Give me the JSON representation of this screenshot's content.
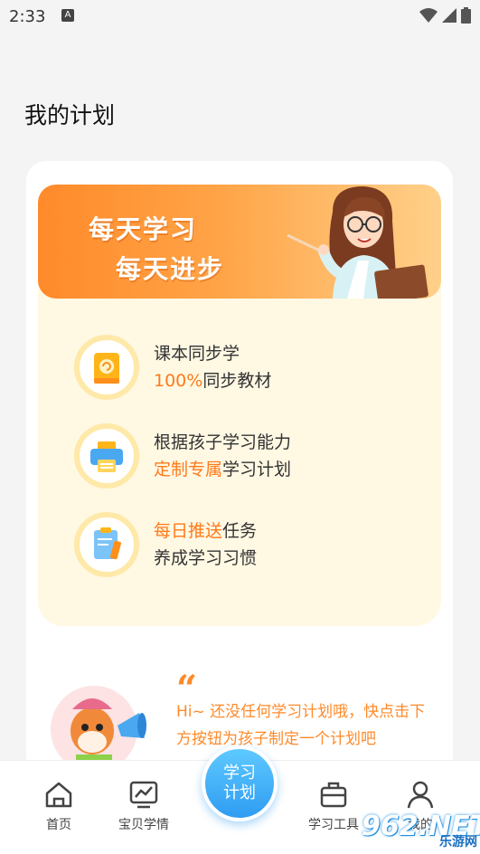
{
  "status_bar": {
    "time": "2:33",
    "notification_letter": "A"
  },
  "page_title": "我的计划",
  "banner": {
    "line1": "每天学习",
    "line2": "每天进步"
  },
  "features": [
    {
      "line1": [
        {
          "text": "课本同步学",
          "hl": false
        }
      ],
      "line2": [
        {
          "text": "100%",
          "hl": true
        },
        {
          "text": "同步教材",
          "hl": false
        }
      ],
      "icon": "textbook-icon"
    },
    {
      "line1": [
        {
          "text": "根据孩子学习能力",
          "hl": false
        }
      ],
      "line2": [
        {
          "text": "定制专属",
          "hl": true
        },
        {
          "text": "学习计划",
          "hl": false
        }
      ],
      "icon": "printer-icon"
    },
    {
      "line1": [
        {
          "text": "每日推送",
          "hl": true
        },
        {
          "text": "任务",
          "hl": false
        }
      ],
      "line2": [
        {
          "text": "养成学习习惯",
          "hl": false
        }
      ],
      "icon": "clipboard-icon"
    }
  ],
  "f1": {
    "a": "课本同步学",
    "b_hl": "100%",
    "b": "同步教材"
  },
  "f2": {
    "a": "根据孩子学习能力",
    "b_hl": "定制专属",
    "b": "学习计划"
  },
  "f3": {
    "a_hl": "每日推送",
    "a": "任务",
    "b": "养成学习习惯"
  },
  "quote_mark": "“",
  "hint_text": "Hi~ 还没任何学习计划哦，快点击下方按钮为孩子制定一个计划吧",
  "tabs": {
    "home": "首页",
    "baby": "宝贝学情",
    "center_line1": "学习",
    "center_line2": "计划",
    "tools": "学习工具",
    "me": "我的"
  },
  "watermark": {
    "main": "962.NET",
    "sub": "乐游网"
  },
  "colors": {
    "accent": "#ff7a1a",
    "blue": "#2f9cf2",
    "panel": "#fff8e3"
  }
}
